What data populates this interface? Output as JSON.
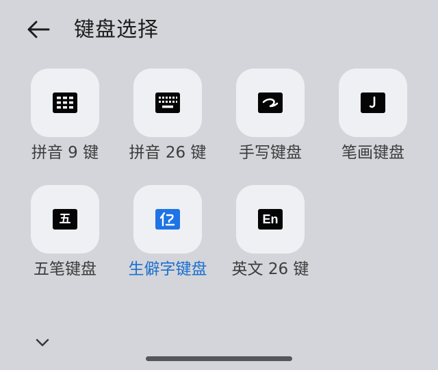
{
  "header": {
    "back_icon": "arrow-left-icon",
    "title": "键盘选择"
  },
  "keyboards": [
    {
      "label": "拼音 9 键",
      "icon": "nine-key-grid-icon",
      "selected": false
    },
    {
      "label": "拼音 26 键",
      "icon": "full-keyboard-icon",
      "selected": false
    },
    {
      "label": "手写键盘",
      "icon": "handwriting-stroke-icon",
      "selected": false
    },
    {
      "label": "笔画键盘",
      "icon": "stroke-icon",
      "selected": false
    },
    {
      "label": "五笔键盘",
      "icon": "wubi-icon",
      "icon_text": "五",
      "selected": false
    },
    {
      "label": "生僻字键盘",
      "icon": "rare-char-icon",
      "selected": true
    },
    {
      "label": "英文 26 键",
      "icon": "english-icon",
      "icon_text": "En",
      "selected": false
    }
  ],
  "footer": {
    "collapse_icon": "chevron-down-icon"
  },
  "colors": {
    "background": "#d4d5da",
    "tile": "#eff0f3",
    "selected_text": "#1a6fd0",
    "selected_icon": "#1e74e6"
  }
}
